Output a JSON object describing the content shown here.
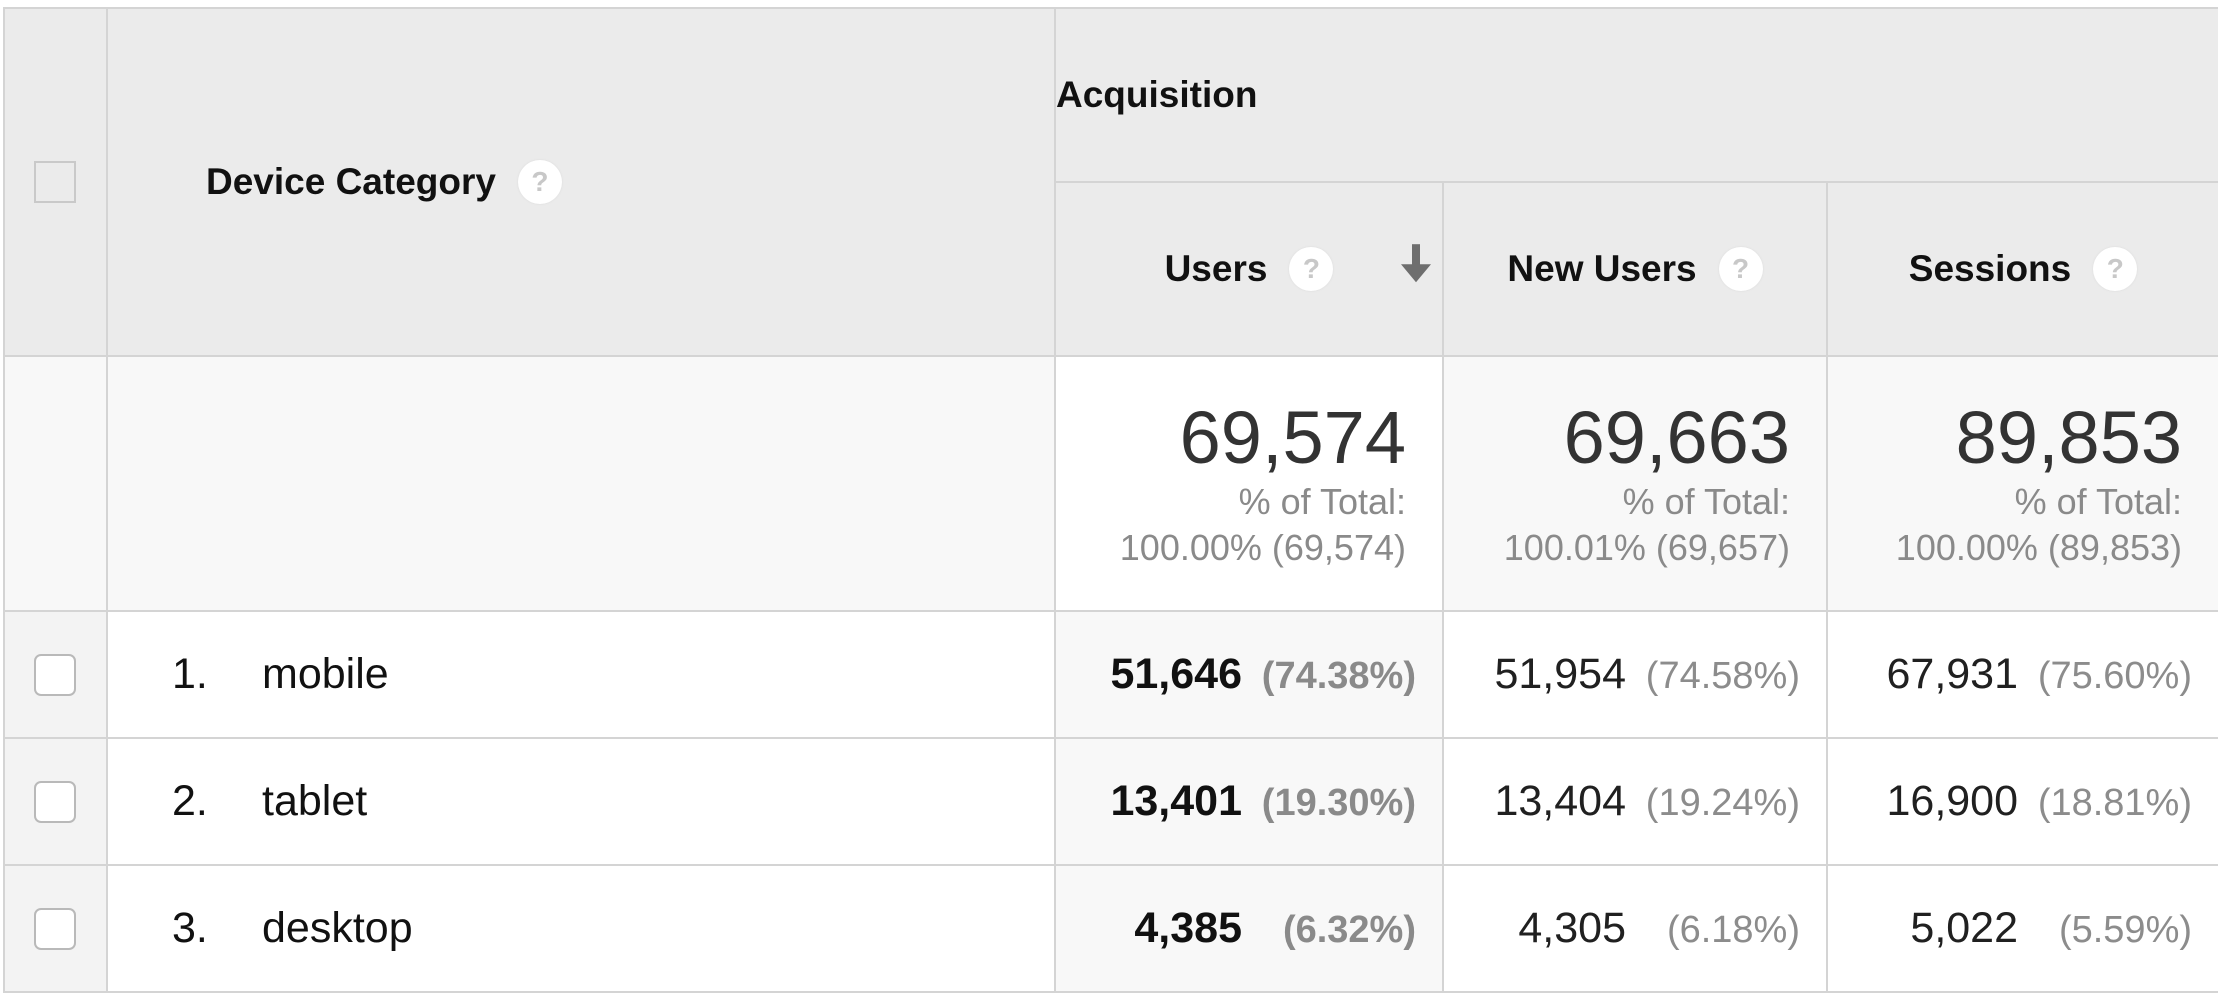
{
  "header": {
    "dimension_label": "Device Category",
    "group_label": "Acquisition",
    "help_glyph": "?",
    "columns": [
      {
        "label": "Users",
        "sorted": "descending"
      },
      {
        "label": "New Users"
      },
      {
        "label": "Sessions"
      }
    ]
  },
  "totals": {
    "users": {
      "value": "69,574",
      "label": "% of Total:",
      "detail": "100.00% (69,574)"
    },
    "new_users": {
      "value": "69,663",
      "label": "% of Total:",
      "detail": "100.01% (69,657)"
    },
    "sessions": {
      "value": "89,853",
      "label": "% of Total:",
      "detail": "100.00% (89,853)"
    }
  },
  "rows": [
    {
      "index": "1.",
      "device": "mobile",
      "users": "51,646",
      "users_pct": "(74.38%)",
      "new_users": "51,954",
      "new_users_pct": "(74.58%)",
      "sessions": "67,931",
      "sessions_pct": "(75.60%)"
    },
    {
      "index": "2.",
      "device": "tablet",
      "users": "13,401",
      "users_pct": "(19.30%)",
      "new_users": "13,404",
      "new_users_pct": "(19.24%)",
      "sessions": "16,900",
      "sessions_pct": "(18.81%)"
    },
    {
      "index": "3.",
      "device": "desktop",
      "users": "4,385",
      "users_pct": "(6.32%)",
      "new_users": "4,305",
      "new_users_pct": "(6.18%)",
      "sessions": "5,022",
      "sessions_pct": "(5.59%)"
    }
  ],
  "colors": {
    "header_bg": "#ebebeb",
    "border": "#d4d4d4",
    "muted_text": "#8c8c8c"
  }
}
